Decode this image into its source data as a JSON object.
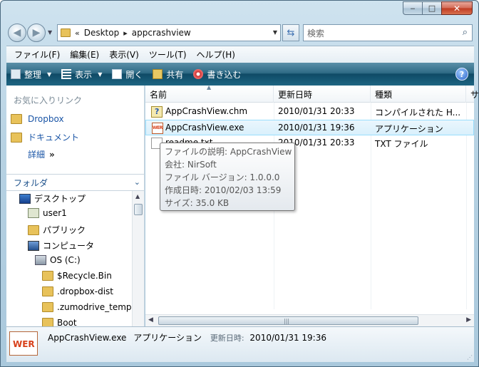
{
  "window": {
    "caption_min": "‒",
    "caption_max": "□",
    "caption_close": "✕"
  },
  "nav": {
    "breadcrumb_root": "«",
    "breadcrumb": [
      "Desktop",
      "appcrashview"
    ],
    "search_placeholder": "検索"
  },
  "menubar": {
    "items": [
      "ファイル(F)",
      "編集(E)",
      "表示(V)",
      "ツール(T)",
      "ヘルプ(H)"
    ]
  },
  "toolbar": {
    "organize": "整理",
    "views": "表示",
    "open": "開く",
    "share": "共有",
    "burn": "書き込む",
    "help": "?"
  },
  "navpane": {
    "favorites_heading": "お気に入りリンク",
    "favorites": [
      "Dropbox",
      "ドキュメント"
    ],
    "more_label": "詳細",
    "more_chevrons": "»",
    "folders_heading": "フォルダ",
    "tree": [
      {
        "label": "デスクトップ",
        "icon": "desktop-icon"
      },
      {
        "label": "user1",
        "icon": "user-icon"
      },
      {
        "label": "パブリック",
        "icon": "folder-icon"
      },
      {
        "label": "コンピュータ",
        "icon": "computer-icon"
      },
      {
        "label": "OS (C:)",
        "icon": "drive-icon"
      },
      {
        "label": "$Recycle.Bin",
        "icon": "folder-icon"
      },
      {
        "label": ".dropbox-dist",
        "icon": "folder-icon"
      },
      {
        "label": ".zumodrive_temp",
        "icon": "folder-icon"
      },
      {
        "label": "Boot",
        "icon": "folder-icon"
      }
    ]
  },
  "filelist": {
    "columns": [
      "名前",
      "更新日時",
      "種類",
      "サ"
    ],
    "rows": [
      {
        "name": "AppCrashView.chm",
        "modified": "2010/01/31 20:33",
        "type": "コンパイルされた H...",
        "icon": "chm-help-icon",
        "selected": false
      },
      {
        "name": "AppCrashView.exe",
        "modified": "2010/01/31 19:36",
        "type": "アプリケーション",
        "icon": "wer-app-icon",
        "selected": true
      },
      {
        "name": "readme.txt",
        "modified": "2010/01/31 20:33",
        "type": "TXT ファイル",
        "icon": "text-file-icon",
        "selected": false
      }
    ]
  },
  "tooltip": {
    "lines": [
      "ファイルの説明: AppCrashView",
      "会社: NirSoft",
      "ファイル バージョン: 1.0.0.0",
      "作成日時: 2010/02/03 13:59",
      "サイズ: 35.0 KB"
    ]
  },
  "details": {
    "icon_text": "WER",
    "name": "AppCrashView.exe",
    "type": "アプリケーション",
    "modified_label": "更新日時:",
    "modified_value": "2010/01/31 19:36"
  },
  "colors": {
    "toolbar_dark": "#0f4a66",
    "selection_border": "#99defd",
    "link_blue": "#1a55a6"
  }
}
